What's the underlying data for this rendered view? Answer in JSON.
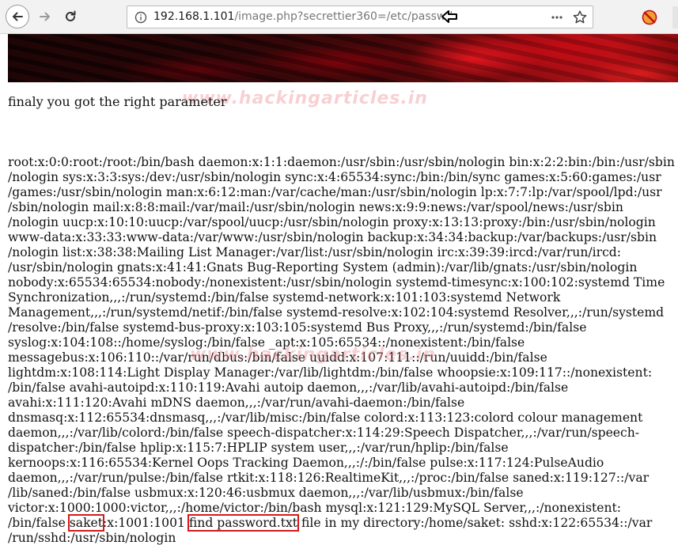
{
  "browser": {
    "url_host": "192.168.1.101",
    "url_path": "/image.php?secrettier360=/etc/passwd"
  },
  "page": {
    "heading": "finaly you got the right parameter",
    "watermark": "www.hackingarticles.in",
    "passwd_lines": [
      "root:x:0:0:root:/root:/bin/bash daemon:x:1:1:daemon:/usr/sbin:/usr/sbin/nologin bin:x:2:2:bin:/bin:/usr/sbin",
      "/nologin sys:x:3:3:sys:/dev:/usr/sbin/nologin sync:x:4:65534:sync:/bin:/bin/sync games:x:5:60:games:/usr",
      "/games:/usr/sbin/nologin man:x:6:12:man:/var/cache/man:/usr/sbin/nologin lp:x:7:7:lp:/var/spool/lpd:/usr",
      "/sbin/nologin mail:x:8:8:mail:/var/mail:/usr/sbin/nologin news:x:9:9:news:/var/spool/news:/usr/sbin",
      "/nologin uucp:x:10:10:uucp:/var/spool/uucp:/usr/sbin/nologin proxy:x:13:13:proxy:/bin:/usr/sbin/nologin",
      "www-data:x:33:33:www-data:/var/www:/usr/sbin/nologin backup:x:34:34:backup:/var/backups:/usr/sbin",
      "/nologin list:x:38:38:Mailing List Manager:/var/list:/usr/sbin/nologin irc:x:39:39:ircd:/var/run/ircd:",
      "/usr/sbin/nologin gnats:x:41:41:Gnats Bug-Reporting System (admin):/var/lib/gnats:/usr/sbin/nologin",
      "nobody:x:65534:65534:nobody:/nonexistent:/usr/sbin/nologin systemd-timesync:x:100:102:systemd Time",
      "Synchronization,,,:/run/systemd:/bin/false systemd-network:x:101:103:systemd Network",
      "Management,,,:/run/systemd/netif:/bin/false systemd-resolve:x:102:104:systemd Resolver,,,:/run/systemd",
      "/resolve:/bin/false systemd-bus-proxy:x:103:105:systemd Bus Proxy,,,:/run/systemd:/bin/false",
      "syslog:x:104:108::/home/syslog:/bin/false _apt:x:105:65534::/nonexistent:/bin/false",
      "messagebus:x:106:110::/var/run/dbus:/bin/false uuidd:x:107:111::/run/uuidd:/bin/false",
      "lightdm:x:108:114:Light Display Manager:/var/lib/lightdm:/bin/false whoopsie:x:109:117::/nonexistent:",
      "/bin/false avahi-autoipd:x:110:119:Avahi autoip daemon,,,:/var/lib/avahi-autoipd:/bin/false",
      "avahi:x:111:120:Avahi mDNS daemon,,,:/var/run/avahi-daemon:/bin/false",
      "dnsmasq:x:112:65534:dnsmasq,,,:/var/lib/misc:/bin/false colord:x:113:123:colord colour management",
      "daemon,,,:/var/lib/colord:/bin/false speech-dispatcher:x:114:29:Speech Dispatcher,,,:/var/run/speech-",
      "dispatcher:/bin/false hplip:x:115:7:HPLIP system user,,,:/var/run/hplip:/bin/false",
      "kernoops:x:116:65534:Kernel Oops Tracking Daemon,,,:/:/bin/false pulse:x:117:124:PulseAudio",
      "daemon,,,:/var/run/pulse:/bin/false rtkit:x:118:126:RealtimeKit,,,:/proc:/bin/false saned:x:119:127::/var",
      "/lib/saned:/bin/false usbmux:x:120:46:usbmux daemon,,,:/var/lib/usbmux:/bin/false",
      "victor:x:1000:1000:victor,,,:/home/victor:/bin/bash mysql:x:121:129:MySQL Server,,,:/nonexistent:"
    ],
    "line_24": {
      "pre": "/bin/false ",
      "saket": "saket",
      "mid": ":x:1001:1001 ",
      "find": "find password.txt",
      "post": " file in my directory:/home/saket: sshd:x:122:65534::/var"
    },
    "line_25": "/run/sshd:/usr/sbin/nologin"
  }
}
